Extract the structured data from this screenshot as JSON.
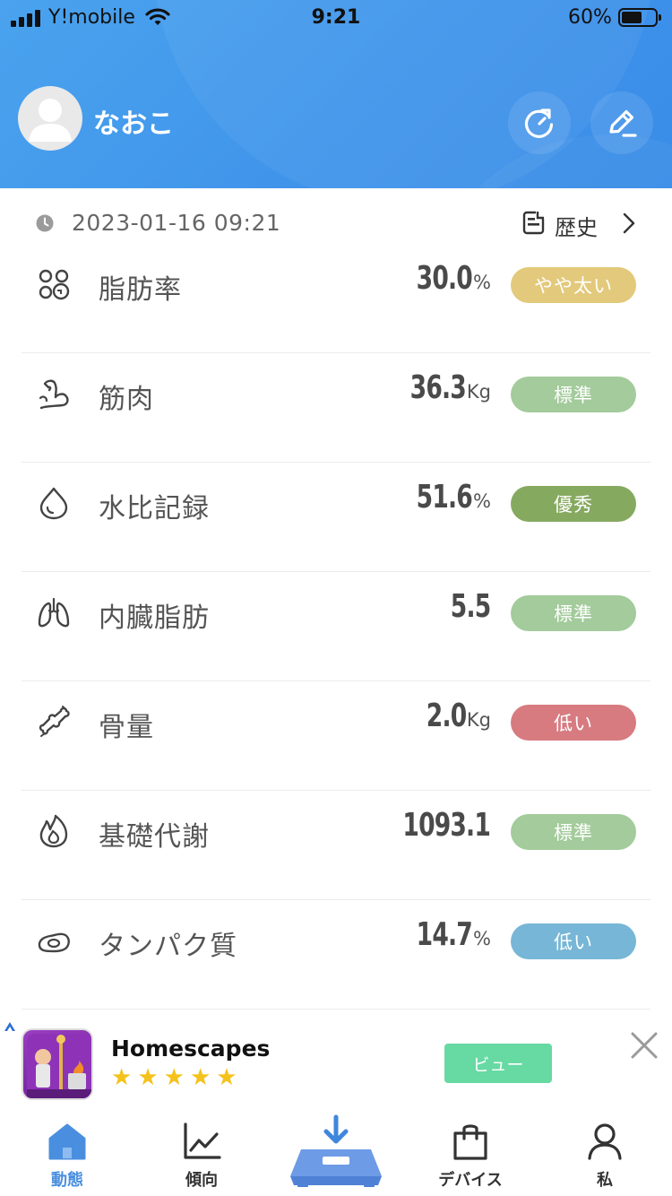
{
  "status_bar": {
    "carrier": "Y!mobile",
    "time": "9:21",
    "battery_pct": "60%",
    "battery_level": 0.6
  },
  "profile": {
    "name": "なおこ"
  },
  "header_buttons": {
    "refresh_icon": "refresh-icon",
    "edit_icon": "edit-icon"
  },
  "measurement": {
    "datetime": "2023-01-16 09:21",
    "history_label": "歴史"
  },
  "metrics": [
    {
      "icon": "body-fat-icon",
      "label": "脂肪率",
      "value": "30.0",
      "unit": "%",
      "status": "やや太い",
      "color": "#e3c97b"
    },
    {
      "icon": "muscle-icon",
      "label": "筋肉",
      "value": "36.3",
      "unit": "Kg",
      "status": "標準",
      "color": "#a3cb9b"
    },
    {
      "icon": "water-drop-icon",
      "label": "水比記録",
      "value": "51.6",
      "unit": "%",
      "status": "優秀",
      "color": "#86a960"
    },
    {
      "icon": "lungs-icon",
      "label": "内臓脂肪",
      "value": "5.5",
      "unit": "",
      "status": "標準",
      "color": "#a3cb9b"
    },
    {
      "icon": "bone-icon",
      "label": "骨量",
      "value": "2.0",
      "unit": "Kg",
      "status": "低い",
      "color": "#d77b80"
    },
    {
      "icon": "flame-icon",
      "label": "基礎代謝",
      "value": "1093.1",
      "unit": "",
      "status": "標準",
      "color": "#a3cb9b"
    },
    {
      "icon": "protein-icon",
      "label": "タンパク質",
      "value": "14.7",
      "unit": "%",
      "status": "低い",
      "color": "#77b6d6"
    }
  ],
  "ad": {
    "title": "Homescapes",
    "rating": 5,
    "button_label": "ビュー"
  },
  "tabs": [
    {
      "label": "動態",
      "icon": "home-icon",
      "active": true
    },
    {
      "label": "傾向",
      "icon": "trend-chart-icon",
      "active": false
    },
    {
      "label": "",
      "icon": "scale-download-icon",
      "active": false
    },
    {
      "label": "デバイス",
      "icon": "device-bag-icon",
      "active": false
    },
    {
      "label": "私",
      "icon": "person-icon",
      "active": false
    }
  ],
  "colors": {
    "header_blue": "#4aa3ee",
    "active_tab": "#4a8fdf"
  }
}
